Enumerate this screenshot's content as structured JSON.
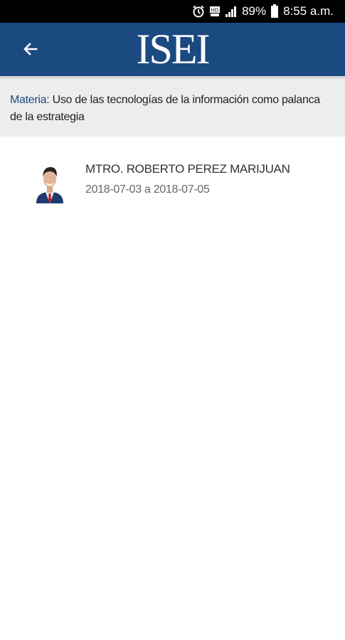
{
  "status_bar": {
    "battery": "89%",
    "time": "8:55 a.m.",
    "icons": [
      "alarm-icon",
      "hd-icon",
      "signal-icon",
      "battery-icon"
    ]
  },
  "header": {
    "logo_text": "ISEI",
    "back_icon": "arrow-left-icon",
    "color": "#1b4a80"
  },
  "subject": {
    "label": "Materia",
    "separator": ":",
    "value": " Uso de las tecnologías de la información como palanca de la estrategia"
  },
  "teachers": [
    {
      "name": "MTRO. ROBERTO PEREZ MARIJUAN",
      "dates": "2018-07-03 a 2018-07-05",
      "avatar": "person-photo"
    }
  ]
}
